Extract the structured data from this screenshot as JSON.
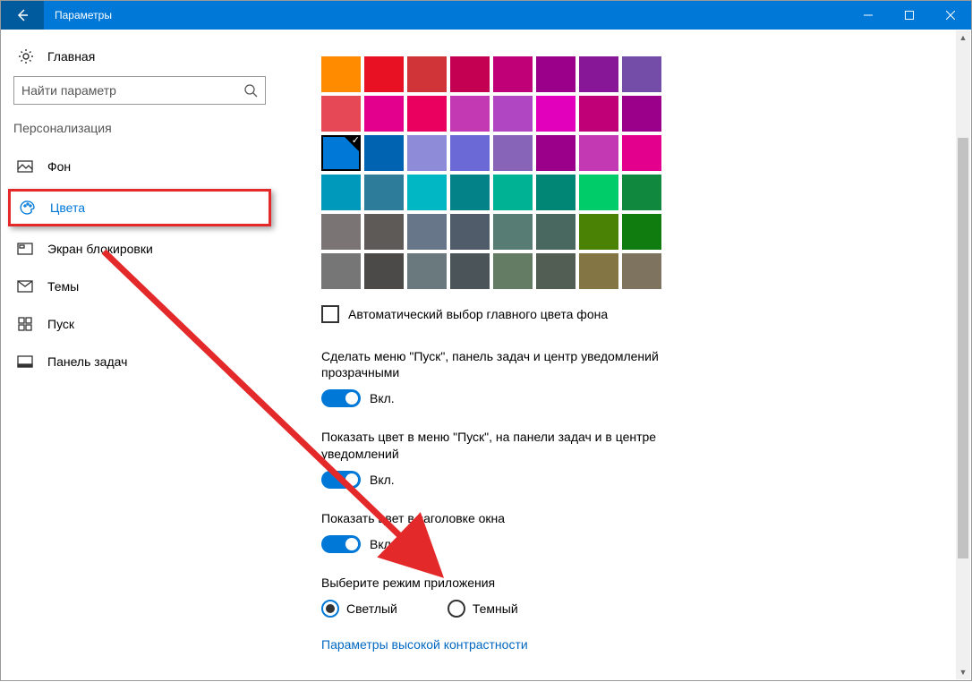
{
  "titlebar": {
    "title": "Параметры"
  },
  "sidebar": {
    "home": "Главная",
    "search_placeholder": "Найти параметр",
    "section": "Персонализация",
    "items": [
      {
        "label": "Фон"
      },
      {
        "label": "Цвета"
      },
      {
        "label": "Экран блокировки"
      },
      {
        "label": "Темы"
      },
      {
        "label": "Пуск"
      },
      {
        "label": "Панель задач"
      }
    ]
  },
  "palette": {
    "selected_index": 16,
    "rows": [
      [
        "#ff8c00",
        "#e81123",
        "#d13438",
        "#c30052",
        "#bf0077",
        "#9a0089",
        "#881798",
        "#744da9"
      ],
      [
        "#e74856",
        "#e3008c",
        "#ea005e",
        "#c239b3",
        "#b146c2",
        "#e300bc",
        "#bf0077",
        "#9a0089"
      ],
      [
        "#0078d7",
        "#0063b1",
        "#8e8cd8",
        "#6b69d6",
        "#8764b8",
        "#9a0089",
        "#c239b3",
        "#e3008c"
      ],
      [
        "#0099bc",
        "#2d7d9a",
        "#00b7c3",
        "#038387",
        "#00b294",
        "#018574",
        "#00cc6a",
        "#10893e"
      ],
      [
        "#7a7574",
        "#5d5a58",
        "#68768a",
        "#515c6b",
        "#567c73",
        "#486860",
        "#498205",
        "#107c10"
      ],
      [
        "#767676",
        "#4c4a48",
        "#69797e",
        "#4a5459",
        "#647c64",
        "#525e54",
        "#847545",
        "#7e735f"
      ]
    ]
  },
  "auto_color_label": "Автоматический выбор главного цвета фона",
  "settings": {
    "transparency_label": "Сделать меню \"Пуск\", панель задач и центр уведомлений прозрачными",
    "show_color_start_label": "Показать цвет в меню \"Пуск\", на панели задач и в центре уведомлений",
    "show_color_title_label": "Показать цвет в заголовке окна",
    "on_text": "Вкл."
  },
  "mode": {
    "label": "Выберите режим приложения",
    "light": "Светлый",
    "dark": "Темный"
  },
  "link": "Параметры высокой контрастности"
}
